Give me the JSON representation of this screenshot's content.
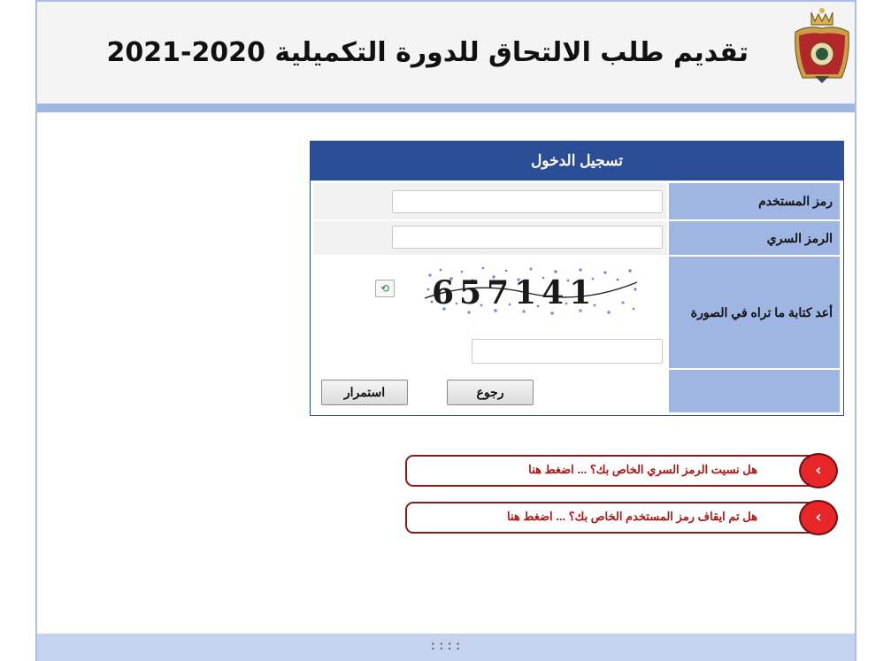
{
  "header": {
    "title": "تقديم طلب الالتحاق للدورة التكميلية 2020-2021"
  },
  "login": {
    "heading": "تسجيل الدخول",
    "username_label": "رمز المستخدم",
    "password_label": "الرمز السري",
    "captcha_label": "أعد كتابة ما تراه في الصورة",
    "captcha_text": "657141",
    "username_value": "",
    "password_value": "",
    "captcha_value": "",
    "continue_label": "استمرار",
    "back_label": "رجوع"
  },
  "links": [
    {
      "text": "هل نسيت الرمز السري الخاص بك؟ ... اضغط هنا"
    },
    {
      "text": "هل تم ايقاف رمز المستخدم الخاص بك؟ ... اضغط هنا"
    }
  ],
  "footer": {
    "text": "::::"
  },
  "colors": {
    "accent": "#2b4d98",
    "label_bg": "#9fb6e3",
    "link_red": "#b01414",
    "circle_red": "#e8262a"
  },
  "icons": {
    "crest": "jordan-crest-icon",
    "refresh": "refresh-icon",
    "chevron": "chevron-left-icon"
  }
}
